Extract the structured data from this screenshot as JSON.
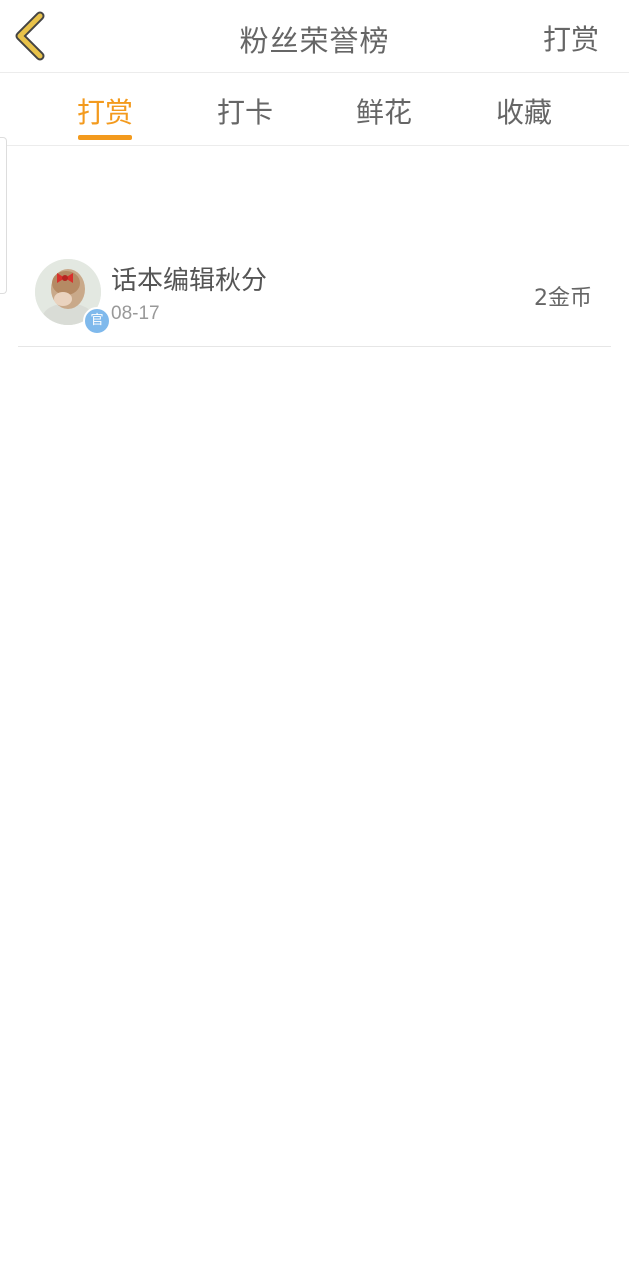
{
  "header": {
    "title": "粉丝荣誉榜",
    "action_label": "打赏",
    "back_icon": "chevron-left-icon",
    "accent_back": "#e8c24a"
  },
  "tabs": [
    {
      "label": "打赏",
      "active": true
    },
    {
      "label": "打卡",
      "active": false
    },
    {
      "label": "鲜花",
      "active": false
    },
    {
      "label": "收藏",
      "active": false
    }
  ],
  "colors": {
    "accent": "#f39a1d",
    "text": "#666666",
    "divider": "#ececec"
  },
  "list": [
    {
      "name": "话本编辑秋分",
      "date": "08-17",
      "amount": "2金币",
      "badge": "官"
    }
  ]
}
